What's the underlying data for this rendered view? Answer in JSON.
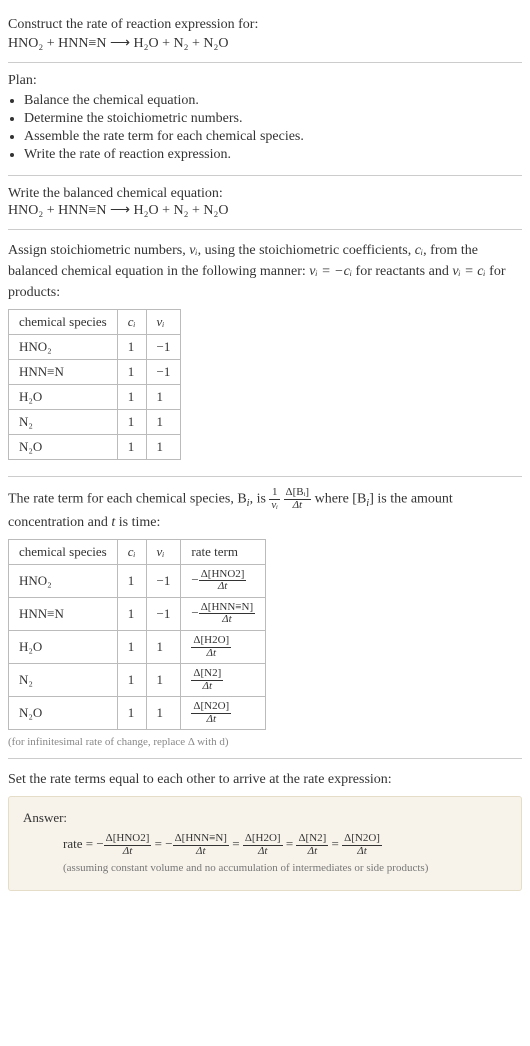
{
  "intro": {
    "heading": "Construct the rate of reaction expression for:",
    "equation_lhs": "HNO₂ + HNN≡N",
    "arrow": " ⟶ ",
    "equation_rhs": "H₂O + N₂ + N₂O"
  },
  "plan": {
    "heading": "Plan:",
    "items": [
      "Balance the chemical equation.",
      "Determine the stoichiometric numbers.",
      "Assemble the rate term for each chemical species.",
      "Write the rate of reaction expression."
    ]
  },
  "balanced": {
    "heading": "Write the balanced chemical equation:",
    "equation_lhs": "HNO₂ + HNN≡N",
    "arrow": " ⟶ ",
    "equation_rhs": "H₂O + N₂ + N₂O"
  },
  "stoich_assign": {
    "text_a": "Assign stoichiometric numbers, ",
    "nu_i": "νᵢ",
    "text_b": ", using the stoichiometric coefficients, ",
    "c_i": "cᵢ",
    "text_c": ", from the balanced chemical equation in the following manner: ",
    "rel_reactants": "νᵢ = −cᵢ",
    "text_d": " for reactants and ",
    "rel_products": "νᵢ = cᵢ",
    "text_e": " for products:"
  },
  "table1": {
    "headers": [
      "chemical species",
      "cᵢ",
      "νᵢ"
    ],
    "rows": [
      {
        "species": "HNO₂",
        "c": "1",
        "nu": "−1"
      },
      {
        "species": "HNN≡N",
        "c": "1",
        "nu": "−1"
      },
      {
        "species": "H₂O",
        "c": "1",
        "nu": "1"
      },
      {
        "species": "N₂",
        "c": "1",
        "nu": "1"
      },
      {
        "species": "N₂O",
        "c": "1",
        "nu": "1"
      }
    ]
  },
  "rate_term_intro": {
    "text_a": "The rate term for each chemical species, B",
    "sub_i": "i",
    "text_b": ", is ",
    "frac1_num": "1",
    "frac1_den": "νᵢ",
    "frac2_num": "Δ[Bᵢ]",
    "frac2_den": "Δt",
    "text_c": " where [B",
    "sub_i2": "i",
    "text_d": "] is the amount concentration and ",
    "t": "t",
    "text_e": " is time:"
  },
  "table2": {
    "headers": [
      "chemical species",
      "cᵢ",
      "νᵢ",
      "rate term"
    ],
    "rows": [
      {
        "species": "HNO₂",
        "c": "1",
        "nu": "−1",
        "rate_sign": "−",
        "rate_num": "Δ[HNO2]",
        "rate_den": "Δt"
      },
      {
        "species": "HNN≡N",
        "c": "1",
        "nu": "−1",
        "rate_sign": "−",
        "rate_num": "Δ[HNN≡N]",
        "rate_den": "Δt"
      },
      {
        "species": "H₂O",
        "c": "1",
        "nu": "1",
        "rate_sign": "",
        "rate_num": "Δ[H2O]",
        "rate_den": "Δt"
      },
      {
        "species": "N₂",
        "c": "1",
        "nu": "1",
        "rate_sign": "",
        "rate_num": "Δ[N2]",
        "rate_den": "Δt"
      },
      {
        "species": "N₂O",
        "c": "1",
        "nu": "1",
        "rate_sign": "",
        "rate_num": "Δ[N2O]",
        "rate_den": "Δt"
      }
    ],
    "footnote": "(for infinitesimal rate of change, replace Δ with d)"
  },
  "conclusion": "Set the rate terms equal to each other to arrive at the rate expression:",
  "answer": {
    "label": "Answer:",
    "rate_label": "rate = ",
    "terms": [
      {
        "sign": "−",
        "num": "Δ[HNO2]",
        "den": "Δt"
      },
      {
        "sign": "−",
        "num": "Δ[HNN≡N]",
        "den": "Δt"
      },
      {
        "sign": "",
        "num": "Δ[H2O]",
        "den": "Δt"
      },
      {
        "sign": "",
        "num": "Δ[N2]",
        "den": "Δt"
      },
      {
        "sign": "",
        "num": "Δ[N2O]",
        "den": "Δt"
      }
    ],
    "eq": " = ",
    "note": "(assuming constant volume and no accumulation of intermediates or side products)"
  }
}
